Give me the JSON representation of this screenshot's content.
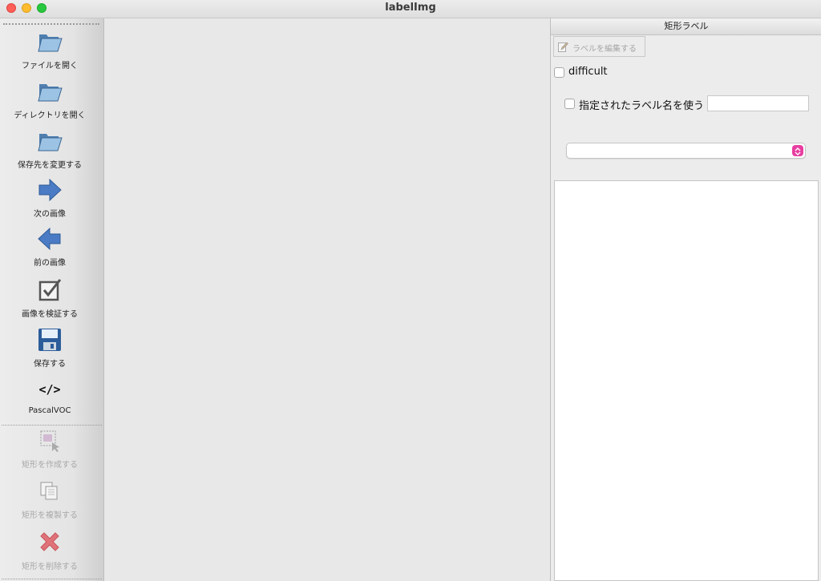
{
  "window": {
    "title": "labelImg"
  },
  "toolbar": {
    "items": [
      {
        "label": "ファイルを開く",
        "icon": "folder-open-icon",
        "enabled": true
      },
      {
        "label": "ディレクトリを開く",
        "icon": "folder-open-icon",
        "enabled": true
      },
      {
        "label": "保存先を変更する",
        "icon": "folder-open-icon",
        "enabled": true
      },
      {
        "label": "次の画像",
        "icon": "arrow-right-icon",
        "enabled": true
      },
      {
        "label": "前の画像",
        "icon": "arrow-left-icon",
        "enabled": true
      },
      {
        "label": "画像を検証する",
        "icon": "checkbox-verify-icon",
        "enabled": true
      },
      {
        "label": "保存する",
        "icon": "save-floppy-icon",
        "enabled": true
      },
      {
        "label": "PascalVOC",
        "icon": "code-format-icon",
        "glyph": "</>",
        "enabled": true
      },
      {
        "label": "矩形を作成する",
        "icon": "create-rect-icon",
        "enabled": false
      },
      {
        "label": "矩形を複製する",
        "icon": "duplicate-rect-icon",
        "enabled": false
      },
      {
        "label": "矩形を削除する",
        "icon": "delete-x-icon",
        "enabled": false
      }
    ]
  },
  "dock": {
    "title": "矩形ラベル",
    "edit_label_button": "ラベルを編集する",
    "difficult_label": "difficult",
    "difficult_checked": false,
    "use_default_label": "指定されたラベル名を使う",
    "use_default_checked": false,
    "default_label_value": "",
    "label_combo_value": ""
  },
  "colors": {
    "accent": "#e83ea0",
    "arrow_blue": "#4a7bc4",
    "delete_red": "#d9363e"
  }
}
